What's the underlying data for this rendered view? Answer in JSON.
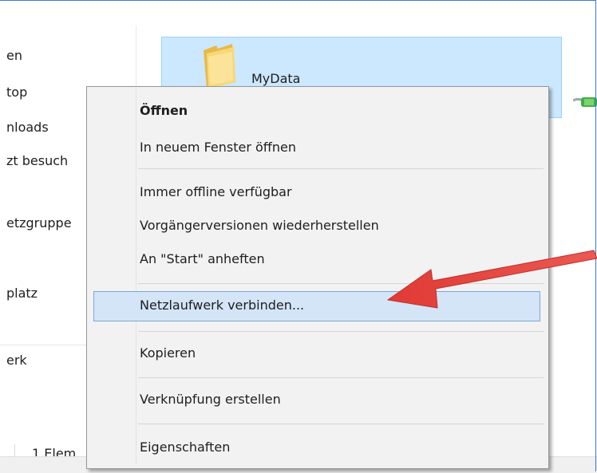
{
  "window": {
    "nav_items": [
      "en",
      "top",
      "nloads",
      "zt besuch",
      "etzgruppe",
      "platz",
      "erk"
    ]
  },
  "content": {
    "folder_name": "MyData"
  },
  "status_bar": {
    "item_count": "1 Elem"
  },
  "context_menu": {
    "items": [
      {
        "label": "Öffnen",
        "bold": true
      },
      {
        "label": "In neuem Fenster öffnen"
      },
      {
        "label": "Immer offline verfügbar"
      },
      {
        "label": "Vorgängerversionen wiederherstellen"
      },
      {
        "label": "An \"Start\" anheften"
      },
      {
        "label": "Netzlaufwerk verbinden...",
        "highlighted": true
      },
      {
        "label": "Kopieren"
      },
      {
        "label": "Verknüpfung erstellen"
      },
      {
        "label": "Eigenschaften"
      }
    ]
  },
  "annotation": {
    "arrow_color": "#e2413c",
    "arrow_icon": "red-pointer-arrow"
  },
  "colors": {
    "selection_bg": "#cce8ff",
    "selection_border": "#99d1ff",
    "menu_highlight": "#d3e5f7",
    "window_border": "#3c78c8"
  }
}
